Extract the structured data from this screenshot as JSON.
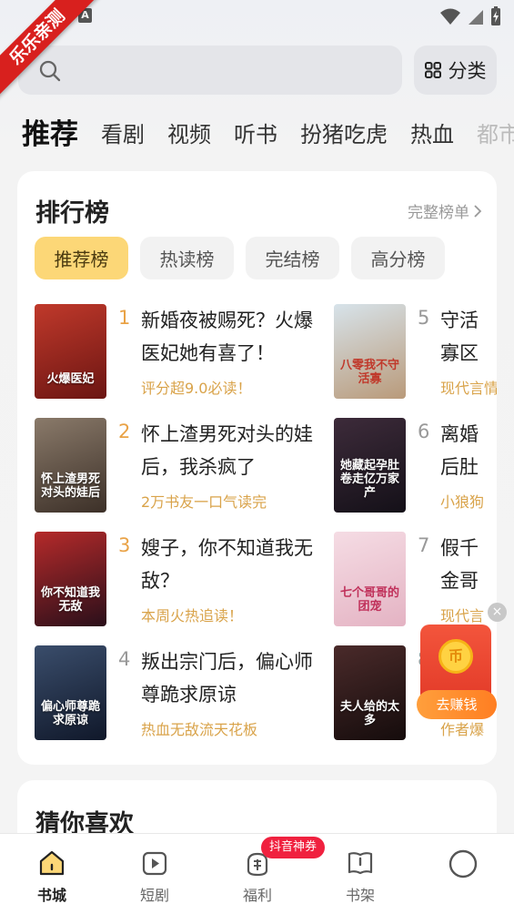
{
  "status": {
    "ribbon": "乐乐亲测",
    "a_badge": "A"
  },
  "search": {
    "category_label": "分类"
  },
  "tabs": [
    "推荐",
    "看剧",
    "视频",
    "听书",
    "扮猪吃虎",
    "热血",
    "都市"
  ],
  "ranking": {
    "title": "排行榜",
    "full_label": "完整榜单",
    "tabs": [
      "推荐榜",
      "热读榜",
      "完结榜",
      "高分榜"
    ],
    "books": [
      {
        "rank": "1",
        "title": "新婚夜被赐死？火爆医妃她有喜了！",
        "tag": "评分超9.0必读！",
        "cover_text": "火爆医妃",
        "cover_colors": [
          "#c0392b",
          "#6b1512"
        ]
      },
      {
        "rank": "2",
        "title": "怀上渣男死对头的娃后，我杀疯了",
        "tag": "2万书友一口气读完",
        "cover_text": "怀上渣男死对头的娃后",
        "cover_colors": [
          "#8a7a6a",
          "#3c3028"
        ]
      },
      {
        "rank": "3",
        "title": "嫂子，你不知道我无敌？",
        "tag": "本周火热追读！",
        "cover_text": "你不知道我无敌",
        "cover_colors": [
          "#b52a2a",
          "#2a0f1a"
        ]
      },
      {
        "rank": "4",
        "title": "叛出宗门后，偏心师尊跪求原谅",
        "tag": "热血无敌流天花板",
        "cover_text": "偏心师尊跪求原谅",
        "cover_colors": [
          "#3a4d6b",
          "#10182a"
        ]
      },
      {
        "rank": "5",
        "title": "守活寡区离婚",
        "tag": "现代言情",
        "cover_text": "八零我不守活寡",
        "cover_colors": [
          "#d7e3ea",
          "#b99a7a"
        ]
      },
      {
        "rank": "6",
        "title": "离婚后肚卷走",
        "tag": "小狼狗",
        "cover_text": "她藏起孕肚卷走亿万家产",
        "cover_colors": [
          "#3d2b3a",
          "#141018"
        ]
      },
      {
        "rank": "7",
        "title": "假千金哥哥的",
        "tag": "现代言",
        "cover_text": "七个哥哥的团宠",
        "cover_colors": [
          "#f5dce4",
          "#e4b3c3"
        ]
      },
      {
        "rank": "8",
        "title": "",
        "tag": "作者爆",
        "cover_text": "夫人给的太多",
        "cover_colors": [
          "#4a2a2a",
          "#150c0c"
        ]
      }
    ]
  },
  "reward": {
    "coin_label": "币",
    "label": "去赚钱",
    "close": "×"
  },
  "guess": {
    "title": "猜你喜欢"
  },
  "nav": {
    "items": [
      {
        "label": "书城",
        "icon": "home-icon"
      },
      {
        "label": "短剧",
        "icon": "play-icon"
      },
      {
        "label": "福利",
        "icon": "gift-bag-icon"
      },
      {
        "label": "书架",
        "icon": "bookshelf-icon"
      },
      {
        "label": "",
        "icon": "profile-circle-icon"
      }
    ],
    "badge": "抖音神券"
  },
  "colors": {
    "accent_yellow": "#fcd777",
    "tag_gold": "#d9a34a",
    "badge_red": "#f0213f"
  }
}
